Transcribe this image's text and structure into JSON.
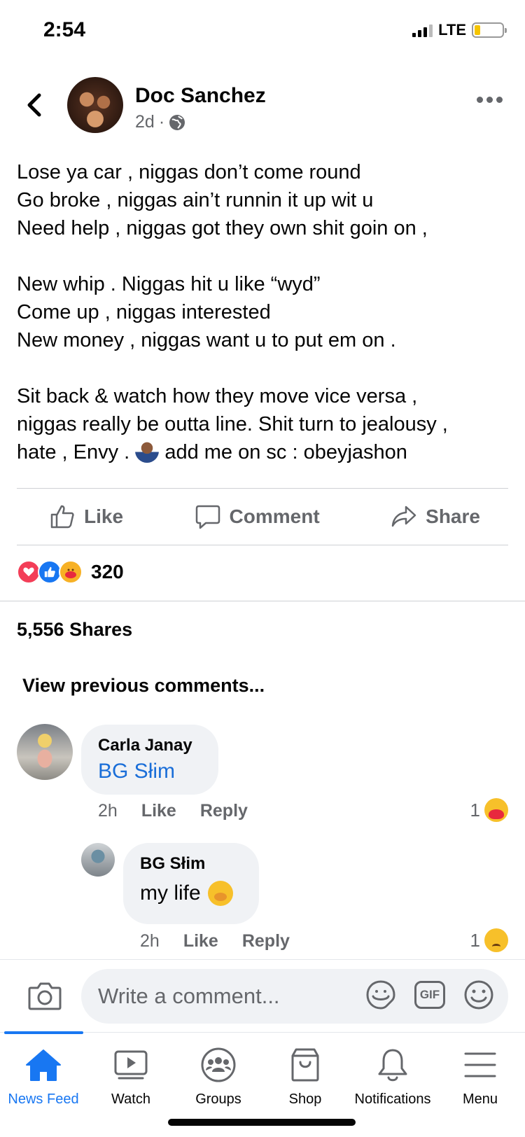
{
  "status_bar": {
    "time": "2:54",
    "network": "LTE",
    "battery_level": 0.2
  },
  "post": {
    "author": "Doc Sanchez",
    "time": "2d",
    "separator": "·",
    "paragraphs": [
      "Lose ya car , niggas don’t come round\nGo broke , niggas ain’t runnin it up wit u\nNeed help , niggas got they own shit goin on ,",
      "New whip . Niggas hit u like “wyd”\nCome up , niggas interested\nNew money , niggas want u to put em on .",
      "Sit back & watch how they move vice versa ,\nniggas really be outta line. Shit turn to jealousy ,\nhate , Envy ."
    ],
    "closing_text": " add me on sc : obeyjashon",
    "actions": {
      "like": "Like",
      "comment": "Comment",
      "share": "Share"
    },
    "reaction_count": "320",
    "shares": "5,556 Shares"
  },
  "comments": {
    "view_previous": "View previous comments...",
    "items": [
      {
        "name": "Carla Janay",
        "text": "BG Słim",
        "time": "2h",
        "like": "Like",
        "reply": "Reply",
        "reaction_count": "1",
        "reaction": "care"
      },
      {
        "name": "BG Słim",
        "text": "my life",
        "time": "2h",
        "like": "Like",
        "reply": "Reply",
        "reaction_count": "1",
        "reaction": "sad"
      }
    ]
  },
  "composer": {
    "placeholder": "Write a comment...",
    "gif": "GIF"
  },
  "tabs": [
    {
      "label": "News Feed",
      "icon": "home-icon",
      "active": true
    },
    {
      "label": "Watch",
      "icon": "watch-icon"
    },
    {
      "label": "Groups",
      "icon": "groups-icon"
    },
    {
      "label": "Shop",
      "icon": "shop-icon"
    },
    {
      "label": "Notifications",
      "icon": "bell-icon"
    },
    {
      "label": "Menu",
      "icon": "menu-icon"
    }
  ],
  "colors": {
    "accent": "#1877f2",
    "secondary_text": "#65676b",
    "bubble": "#f0f2f5"
  }
}
